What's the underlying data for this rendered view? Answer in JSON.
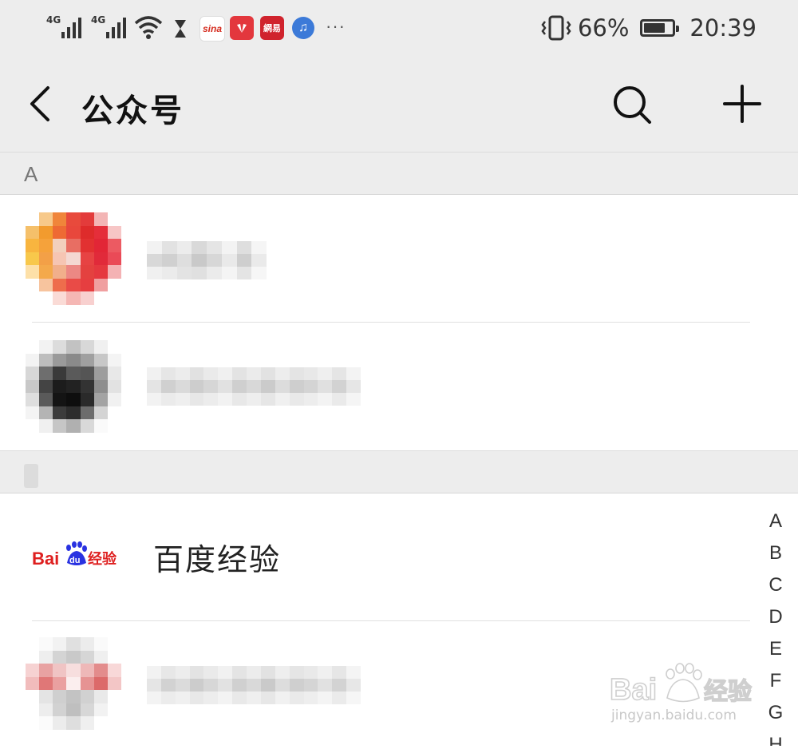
{
  "status_bar": {
    "signal_1_label": "4G",
    "signal_2_label": "4G",
    "app_icons": [
      "sina",
      "huawei",
      "网易",
      "music"
    ],
    "more": "···",
    "battery_percent": "66%",
    "time": "20:39"
  },
  "nav": {
    "title": "公众号",
    "back_icon": "chevron-left-icon",
    "search_icon": "search-icon",
    "add_icon": "plus-icon"
  },
  "sections": [
    {
      "letter": "A"
    },
    {
      "letter": ""
    }
  ],
  "list": {
    "baidu_item_name": "百度经验",
    "baidu_logo_text": "Bai经验"
  },
  "index_letters": [
    "A",
    "B",
    "C",
    "D",
    "E",
    "F",
    "G",
    "H"
  ],
  "watermark": {
    "logo_text": "Bai经验",
    "url": "jingyan.baidu.com"
  },
  "colors": {
    "background": "#ededed",
    "row_background": "#ffffff",
    "baidu_red": "#de1f1f",
    "baidu_blue": "#2932e1"
  }
}
